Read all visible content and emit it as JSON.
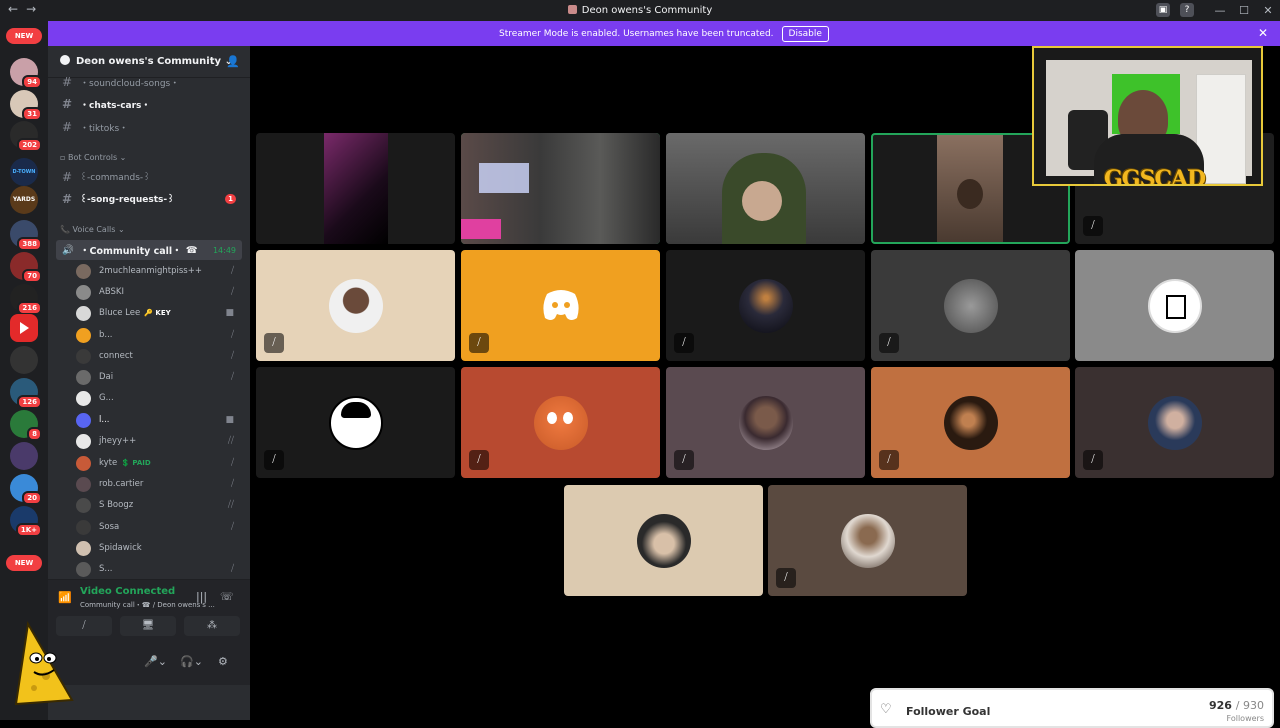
{
  "window": {
    "title": "Deon owens's Community"
  },
  "streamer_banner": {
    "text": "Streamer Mode is enabled. Usernames have been truncated.",
    "button": "Disable"
  },
  "guilds": {
    "new_label": "NEW",
    "badges": [
      "94",
      "31",
      "202",
      "388",
      "70",
      "216",
      "126",
      "8",
      "20",
      "1K+"
    ],
    "labels": [
      "D-TOWN",
      "YARDS"
    ]
  },
  "server": {
    "name": "Deon owens's Community",
    "channels": [
      {
        "name": "・soundcloud-songs・",
        "unread": false
      },
      {
        "name": "・chats-cars・",
        "unread": true
      },
      {
        "name": "・tiktoks・",
        "unread": false
      }
    ],
    "bot_category": "Bot Controls",
    "bot_channels": [
      {
        "name": "꒰-commands-꒱",
        "unread": false
      },
      {
        "name": "꒰-song-requests-꒱",
        "unread": true,
        "mentions": "1"
      }
    ],
    "voice_category": "Voice Calls",
    "voice_channel": {
      "name": "・Community call・",
      "time": "14:49"
    },
    "members": [
      {
        "name": "2muchleanmightpiss++",
        "tag": "",
        "color": "#7a6a60"
      },
      {
        "name": "ABSKI",
        "tag": "",
        "color": "#8a8a8a"
      },
      {
        "name": "Bluce Lee",
        "tag": "KEY",
        "color": "#d8d8d8"
      },
      {
        "name": "b...",
        "tag": "",
        "color": "#f0a020"
      },
      {
        "name": "connect",
        "tag": "",
        "color": "#3a3a3a"
      },
      {
        "name": "Dai",
        "tag": "",
        "color": "#6a6a6a"
      },
      {
        "name": "G...",
        "tag": "",
        "color": "#e8e8e8"
      },
      {
        "name": "l...",
        "tag": "",
        "color": "#5865f2"
      },
      {
        "name": "jheyy++",
        "tag": "",
        "color": "#e8e8e8"
      },
      {
        "name": "kyte",
        "tag": "PAID",
        "color": "#c85a38"
      },
      {
        "name": "rob.cartier",
        "tag": "",
        "color": "#5a4a50"
      },
      {
        "name": "S Boogz",
        "tag": "",
        "color": "#4a4a4a"
      },
      {
        "name": "Sosa",
        "tag": "",
        "color": "#3a3a3a"
      },
      {
        "name": "Spidawick",
        "tag": "",
        "color": "#d0c0b0"
      },
      {
        "name": "S...",
        "tag": "",
        "color": "#5a5a5a"
      }
    ]
  },
  "voice_status": {
    "status": "Video Connected",
    "detail": "Community call・☎ / Deon owens's ..."
  },
  "overlay": {
    "streamer_logo": "GGSCAD",
    "goal_label": "Follower Goal",
    "goal_current": "926",
    "goal_total": "930",
    "goal_unit": "Followers"
  }
}
